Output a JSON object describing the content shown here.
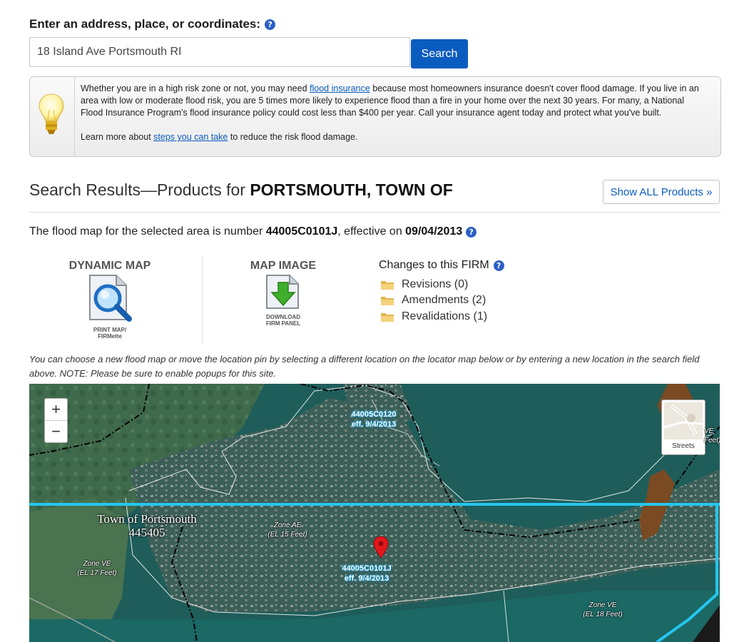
{
  "search": {
    "label": "Enter an address, place, or coordinates:",
    "value": "18 Island Ave Portsmouth RI",
    "button": "Search"
  },
  "info": {
    "p1_a": "Whether you are in a high risk zone or not, you may need ",
    "p1_link": "flood insurance",
    "p1_b": " because most homeowners insurance doesn't cover flood damage. If you live in an area with low or moderate flood risk, you are 5 times more likely to experience flood than a fire in your home over the next 30 years. For many, a National Flood Insurance Program's flood insurance policy could cost less than $400 per year. Call your insurance agent today and protect what you've built.",
    "p2_a": "Learn more about ",
    "p2_link": "steps you can take",
    "p2_b": " to reduce the risk flood damage."
  },
  "results": {
    "title_prefix": "Search Results—Products for ",
    "community": "PORTSMOUTH, TOWN OF",
    "show_all": "Show ALL Products »",
    "flood_prefix": "The flood map for the selected area is number ",
    "panel_number": "44005C0101J",
    "effective_text": ", effective on ",
    "effective_date": "09/04/2013"
  },
  "products": {
    "dynamic_map": "DYNAMIC MAP",
    "dynamic_caption1": "PRINT MAP/",
    "dynamic_caption2": "FIRMette",
    "map_image": "MAP IMAGE",
    "image_caption1": "DOWNLOAD",
    "image_caption2": "FIRM PANEL"
  },
  "changes": {
    "title": "Changes to this FIRM",
    "items": [
      "Revisions (0)",
      "Amendments (2)",
      "Revalidations (1)"
    ]
  },
  "note": "You can choose a new flood map or move the location pin by selecting a different location on the locator map below or by entering a new location in the search field above. NOTE: Please be sure to enable popups for this site.",
  "map": {
    "zoom_in": "+",
    "zoom_out": "−",
    "basemap_label": "Streets",
    "panel_top_1": "44005C0120",
    "panel_top_2": "eff. 9/4/2013",
    "panel_main_1": "44005C0101J",
    "panel_main_2": "eff. 9/4/2013",
    "town_1": "Town of Portsmouth",
    "town_2": "445405",
    "zone_ae_1": "Zone AE",
    "zone_ae_2": "(EL 15 Feet)",
    "zone_ve_left_1": "Zone VE",
    "zone_ve_left_2": "(EL 17 Feet)",
    "zone_ve_right_1": "Zone VE",
    "zone_ve_right_2": "(EL 18 Feet)",
    "zone_ve_edge_1": "VE",
    "zone_ve_edge_2": "Feet)"
  }
}
